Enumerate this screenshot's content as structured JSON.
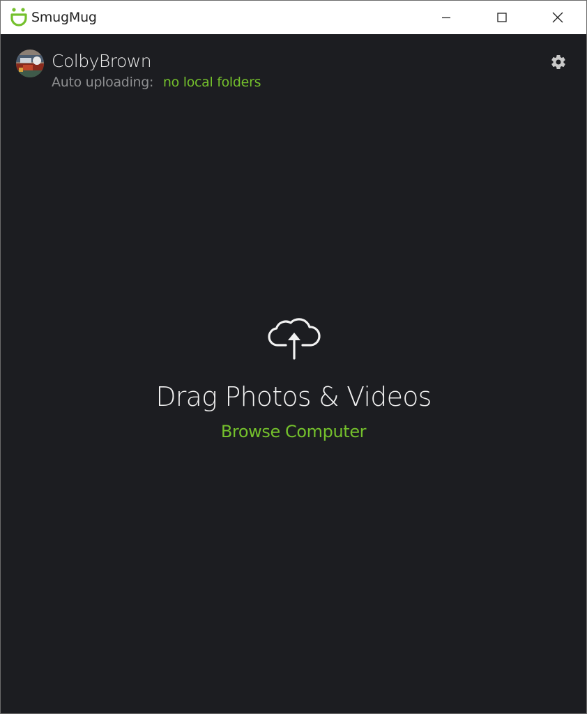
{
  "window": {
    "title": "SmugMug",
    "controls": {
      "minimize": "minimize-icon",
      "maximize": "maximize-icon",
      "close": "close-icon"
    }
  },
  "header": {
    "username": "ColbyBrown",
    "auto_upload_label": "Auto uploading:",
    "auto_upload_value": "no local folders",
    "settings_icon": "gear-icon"
  },
  "drop_zone": {
    "icon": "cloud-upload-icon",
    "title": "Drag Photos & Videos",
    "browse_label": "Browse Computer"
  },
  "colors": {
    "accent": "#74c02c",
    "background": "#1c1d21",
    "titlebar": "#ffffff",
    "primary_text": "#f2f2f2",
    "secondary_text": "#8d8e90"
  }
}
